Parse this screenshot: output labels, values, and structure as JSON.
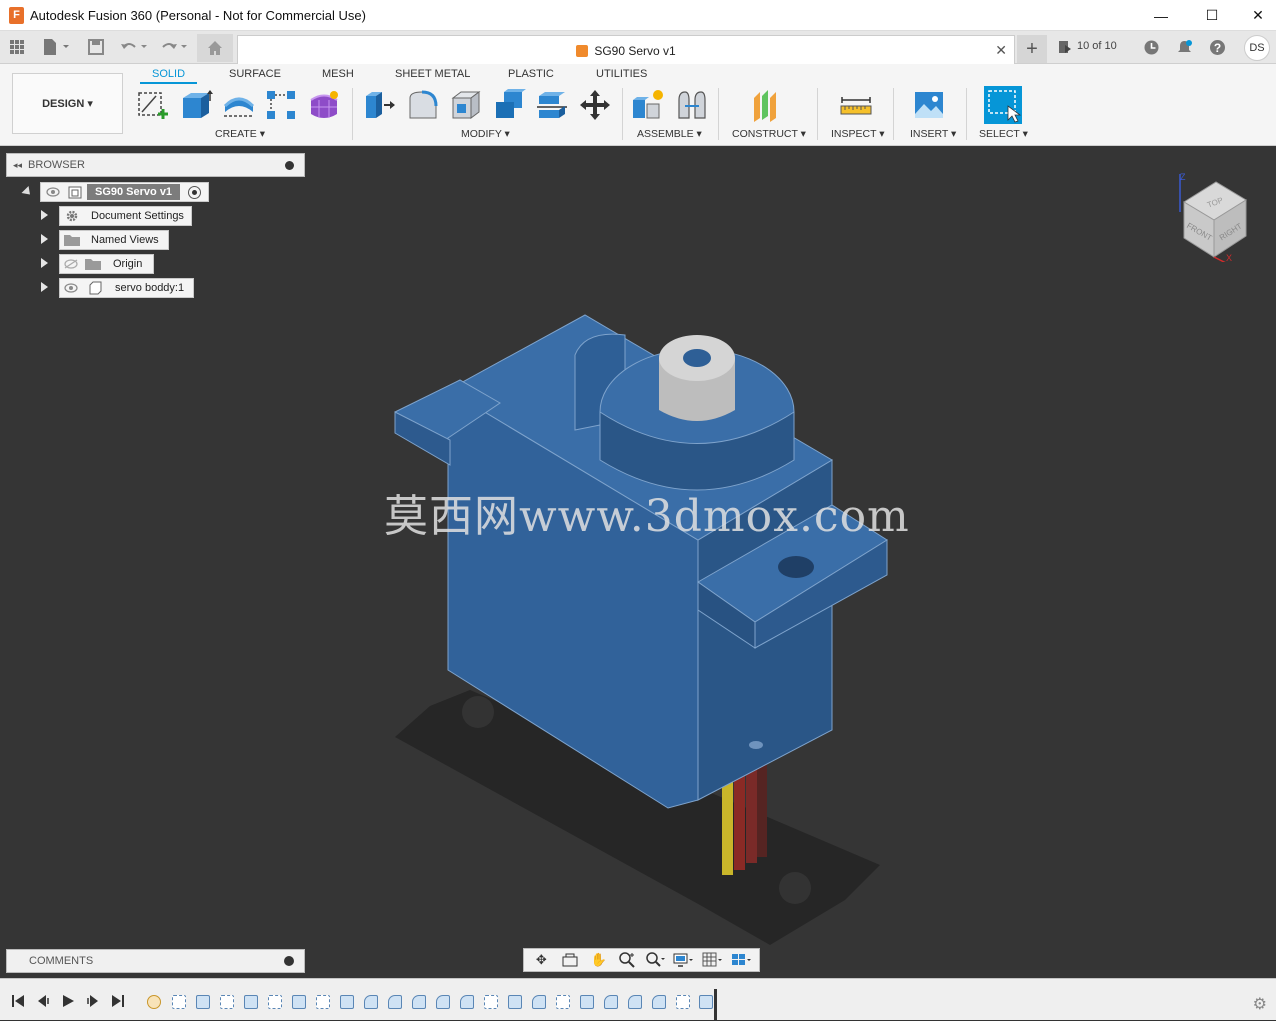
{
  "window": {
    "title": "Autodesk Fusion 360 (Personal - Not for Commercial Use)",
    "app_icon_letter": "F",
    "minimize_glyph": "—",
    "maximize_glyph": "☐",
    "close_glyph": "✕"
  },
  "tabbar": {
    "doc_title": "SG90 Servo v1",
    "close_glyph": "✕",
    "add_glyph": "+",
    "job_status": "10 of 10",
    "user_initials": "DS"
  },
  "ribbon": {
    "workspace": "DESIGN ▾",
    "tabs": [
      "SOLID",
      "SURFACE",
      "MESH",
      "SHEET METAL",
      "PLASTIC",
      "UTILITIES"
    ],
    "groups": [
      "CREATE ▾",
      "MODIFY ▾",
      "ASSEMBLE ▾",
      "CONSTRUCT ▾",
      "INSPECT ▾",
      "INSERT ▾",
      "SELECT ▾"
    ]
  },
  "browser": {
    "title": "BROWSER",
    "root": "SG90 Servo v1",
    "items": [
      "Document Settings",
      "Named Views",
      "Origin",
      "servo boddy:1"
    ]
  },
  "viewcube": {
    "top": "TOP",
    "front": "FRONT",
    "right": "RIGHT",
    "z": "Z",
    "x": "X"
  },
  "comments": {
    "title": "COMMENTS"
  },
  "watermark": "莫西网www.3dmox.com",
  "colors": {
    "accent": "#0696d7",
    "model_blue": "#2f5b8a",
    "canvas": "#353535"
  }
}
